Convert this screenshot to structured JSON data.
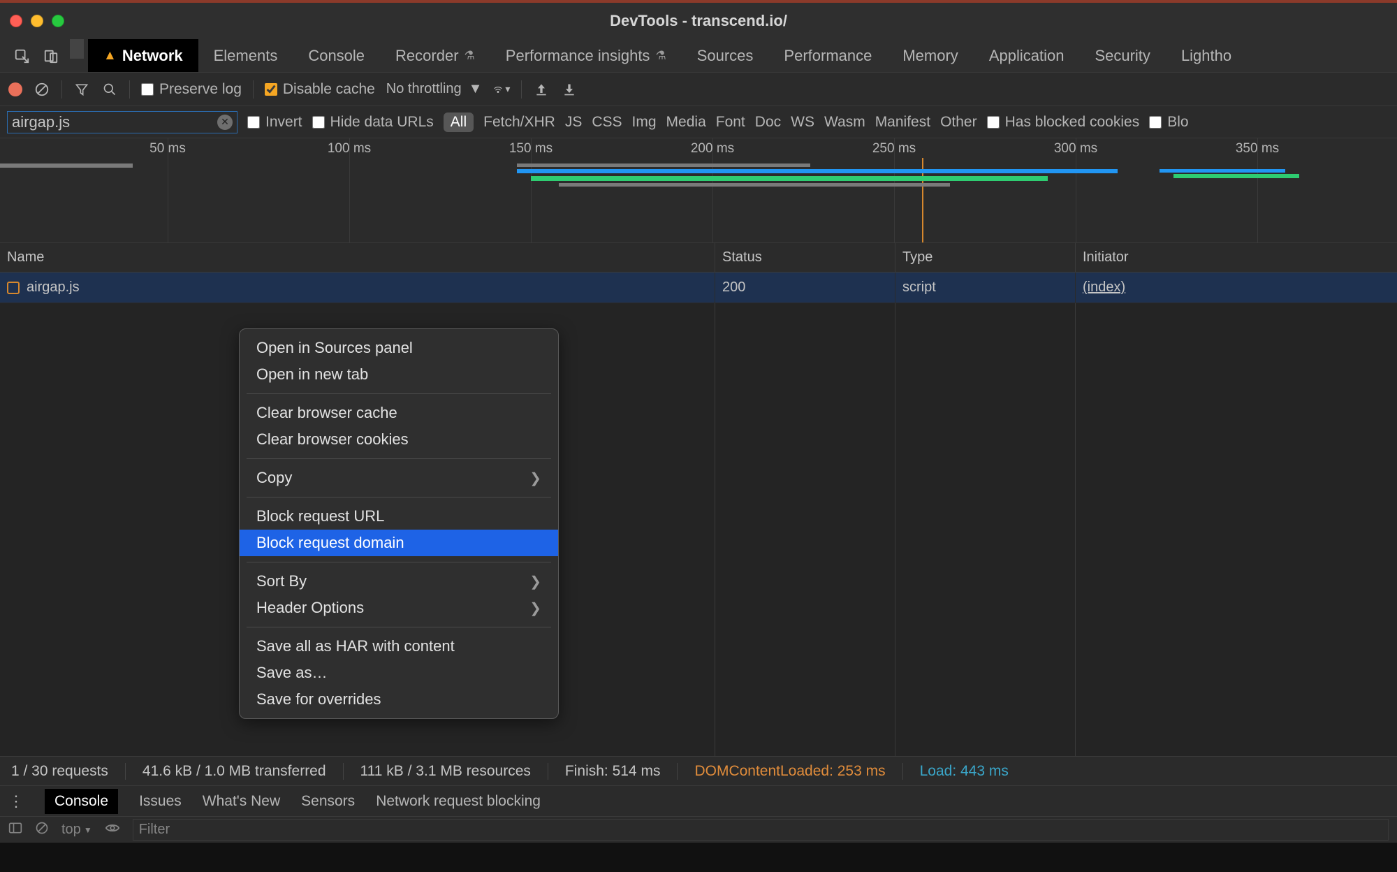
{
  "window": {
    "title": "DevTools - transcend.io/"
  },
  "main_tabs": {
    "items": [
      "Network",
      "Elements",
      "Console",
      "Recorder",
      "Performance insights",
      "Sources",
      "Performance",
      "Memory",
      "Application",
      "Security",
      "Lightho"
    ],
    "active": "Network",
    "beaker_tabs": [
      "Recorder",
      "Performance insights"
    ]
  },
  "toolbar": {
    "preserve_log": "Preserve log",
    "disable_cache": "Disable cache",
    "throttling": "No throttling"
  },
  "filterbar": {
    "input_value": "airgap.js",
    "invert": "Invert",
    "hide_data_urls": "Hide data URLs",
    "types": [
      "All",
      "Fetch/XHR",
      "JS",
      "CSS",
      "Img",
      "Media",
      "Font",
      "Doc",
      "WS",
      "Wasm",
      "Manifest",
      "Other"
    ],
    "selected": "All",
    "has_blocked_cookies": "Has blocked cookies",
    "blocked_requests": "Blo"
  },
  "timeline": {
    "ticks": [
      "50 ms",
      "100 ms",
      "150 ms",
      "200 ms",
      "250 ms",
      "300 ms",
      "350 ms"
    ]
  },
  "columns": {
    "name": "Name",
    "status": "Status",
    "type": "Type",
    "initiator": "Initiator"
  },
  "rows": [
    {
      "name": "airgap.js",
      "status": "200",
      "type": "script",
      "initiator": "(index)"
    }
  ],
  "context_menu": {
    "groups": [
      [
        "Open in Sources panel",
        "Open in new tab"
      ],
      [
        "Clear browser cache",
        "Clear browser cookies"
      ],
      [
        "Copy"
      ],
      [
        "Block request URL",
        "Block request domain"
      ],
      [
        "Sort By",
        "Header Options"
      ],
      [
        "Save all as HAR with content",
        "Save as…",
        "Save for overrides"
      ]
    ],
    "submenu_items": [
      "Copy",
      "Sort By",
      "Header Options"
    ],
    "hover": "Block request domain"
  },
  "statusbar": {
    "requests": "1 / 30 requests",
    "transferred": "41.6 kB / 1.0 MB transferred",
    "resources": "111 kB / 3.1 MB resources",
    "finish": "Finish: 514 ms",
    "dom": "DOMContentLoaded: 253 ms",
    "load": "Load: 443 ms"
  },
  "drawer": {
    "tabs": [
      "Console",
      "Issues",
      "What's New",
      "Sensors",
      "Network request blocking"
    ],
    "active": "Console",
    "filter_placeholder": "Filter",
    "top_label": "top"
  }
}
